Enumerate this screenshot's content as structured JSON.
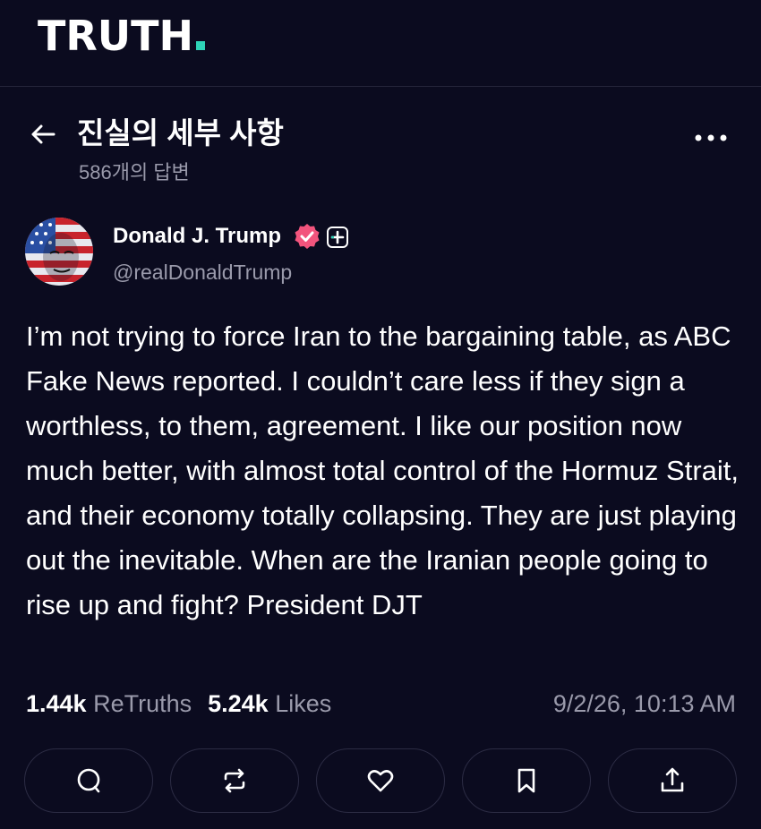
{
  "app": {
    "logo_text": "TRUTH",
    "accent_color": "#2ed3b7"
  },
  "header": {
    "title": "진실의 세부 사항",
    "reply_count": "586개의 답변",
    "back_icon": "arrow-left-icon",
    "more_icon": "more-horizontal-icon"
  },
  "post": {
    "author_name": "Donald J. Trump",
    "handle": "@realDonaldTrump",
    "verified_color": "#f2547d",
    "body": "I’m not trying to force Iran to the bargaining table, as ABC Fake News reported. I couldn’t care less if they sign a worthless, to them, agreement. I like our position now much better, with almost total control of the Hormuz Strait, and their economy totally collapsing. They are just playing out the inevitable. When are the Iranian people going to rise up and fight? President DJT",
    "retruths_count": "1.44k",
    "retruths_label": "ReTruths",
    "likes_count": "5.24k",
    "likes_label": "Likes",
    "timestamp": "9/2/26, 10:13 AM"
  },
  "actions": [
    {
      "icon": "reply-icon"
    },
    {
      "icon": "retruth-icon"
    },
    {
      "icon": "heart-icon"
    },
    {
      "icon": "bookmark-icon"
    },
    {
      "icon": "share-icon"
    }
  ]
}
